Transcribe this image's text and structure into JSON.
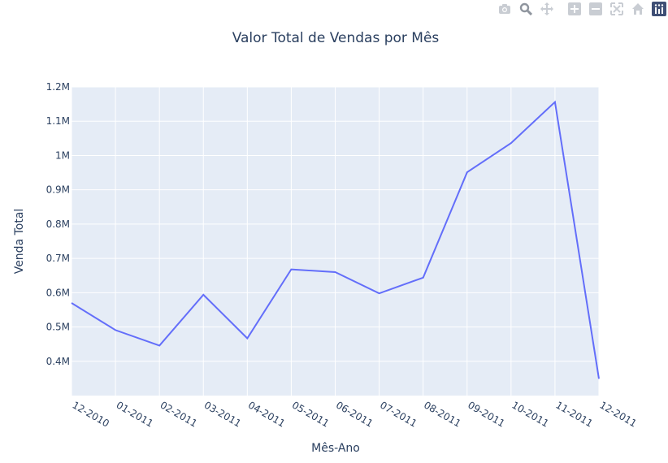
{
  "chart_data": {
    "type": "line",
    "title": "Valor Total de Vendas por Mês",
    "xlabel": "Mês-Ano",
    "ylabel": "Venda Total",
    "categories": [
      "12-2010",
      "01-2011",
      "02-2011",
      "03-2011",
      "04-2011",
      "05-2011",
      "06-2011",
      "07-2011",
      "08-2011",
      "09-2011",
      "10-2011",
      "11-2011",
      "12-2011"
    ],
    "series": [
      {
        "values": [
          570000,
          491000,
          446000,
          594000,
          467000,
          668000,
          660000,
          598000,
          644000,
          951000,
          1036000,
          1156000,
          349000
        ]
      }
    ],
    "ylim": [
      300000,
      1200000
    ],
    "yticks": [
      400000,
      500000,
      600000,
      700000,
      800000,
      900000,
      1000000,
      1100000,
      1200000
    ],
    "ytick_labels": [
      "0.4M",
      "0.5M",
      "0.6M",
      "0.7M",
      "0.8M",
      "0.9M",
      "1M",
      "1.1M",
      "1.2M"
    ],
    "grid": true,
    "line_color": "#636efa",
    "plot_background": "#e5ecf6"
  },
  "modebar": {
    "buttons": [
      "camera-icon",
      "zoom-icon",
      "pan-icon",
      "zoom-in-icon",
      "zoom-out-icon",
      "autoscale-icon",
      "home-icon",
      "plotly-logo-icon"
    ]
  }
}
